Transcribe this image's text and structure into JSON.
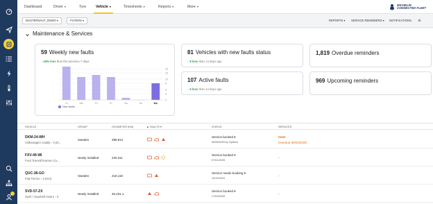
{
  "nav": {
    "items": [
      {
        "label": "Dashboard",
        "caret": false
      },
      {
        "label": "Driver",
        "caret": true
      },
      {
        "label": "Tyre",
        "caret": false
      },
      {
        "label": "Vehicle",
        "caret": true
      },
      {
        "label": "Timesheets",
        "caret": true
      },
      {
        "label": "Reports",
        "caret": true
      },
      {
        "label": "More",
        "caret": true
      }
    ],
    "active": "Vehicle",
    "logo_line1": "MICHELIN",
    "logo_line2": "CONNECTED FLEET"
  },
  "toolbar": {
    "account": "MASTERNAUT_DEMO",
    "filters": "FILTERS",
    "reports": "REPORTS",
    "service_reminders": "SERVICE REMINDERS",
    "notifications": "NOTIFICATIONS"
  },
  "section": {
    "title": "Maintenance & Services"
  },
  "cards": {
    "weekly_faults": {
      "count": "59",
      "label": "Weekly new faults",
      "delta": "34% less",
      "delta_suffix": "than the previous 7 days"
    },
    "vehicles_faults": {
      "count": "81",
      "label": "Vehicles with new faults status",
      "delta": "8 less",
      "delta_suffix": "than 14 days ago"
    },
    "overdue": {
      "count": "1,819",
      "label": "Overdue reminders"
    },
    "active_faults": {
      "count": "107",
      "label": "Active faults",
      "delta": "5 less",
      "delta_suffix": "than 14 days ago"
    },
    "upcoming": {
      "count": "969",
      "label": "Upcoming reminders"
    }
  },
  "chart_data": {
    "type": "bar",
    "categories": [
      "Tu",
      "We",
      "Th",
      "Fr",
      "Sa",
      "Su",
      "Mo"
    ],
    "series": [
      {
        "name": "New faults",
        "values": [
          16,
          11,
          12,
          11,
          1,
          0,
          8
        ]
      }
    ],
    "yticks": [
      "0",
      "3",
      "5",
      "8",
      "10",
      "13",
      "15"
    ],
    "ylim": [
      0,
      15
    ],
    "grid": true,
    "legend": "bottom-left",
    "color": "#7b6ee0",
    "highlight_color": "#b9b2ee"
  },
  "table": {
    "headers": {
      "vehicle": "VEHICLE",
      "group": "GROUP",
      "odometer": "ODOMETER (KM)",
      "faults": "FAULTS",
      "status": "STATUS",
      "services": "SERVICES"
    },
    "rows": [
      {
        "plate": "DKM-24-WH",
        "model": "Volkswagen Caddy - 3 ph...",
        "group": "Sweden",
        "odometer": "398,912",
        "status": "Service booked",
        "status_sub": "06/05/2025 by System",
        "service": "teste",
        "service_sub": "Overdue 30/03/2025"
      },
      {
        "plate": "FXV-49-WI",
        "model": "Ford Transit/Tourneo Cu...",
        "group": "Newly Installed",
        "odometer": "220,311",
        "status": "Service booked",
        "status_sub": "07/01/2025",
        "service": "-",
        "service_sub": ""
      },
      {
        "plate": "QUC-38-GO",
        "model": "Fiat Fiorino - 3 (Km)",
        "group": "Sweden",
        "odometer": "218,118",
        "status": "Service needs booking",
        "status_sub": "10/10/2024",
        "service": "-",
        "service_sub": ""
      },
      {
        "plate": "SVD-57-ZX",
        "model": "Opel / Vauxhall Vivaro - 3",
        "group": "Newly Installed",
        "odometer": "45,231.1",
        "status": "Service booked",
        "status_sub": "17/03/2025",
        "service": "-",
        "service_sub": ""
      }
    ]
  }
}
